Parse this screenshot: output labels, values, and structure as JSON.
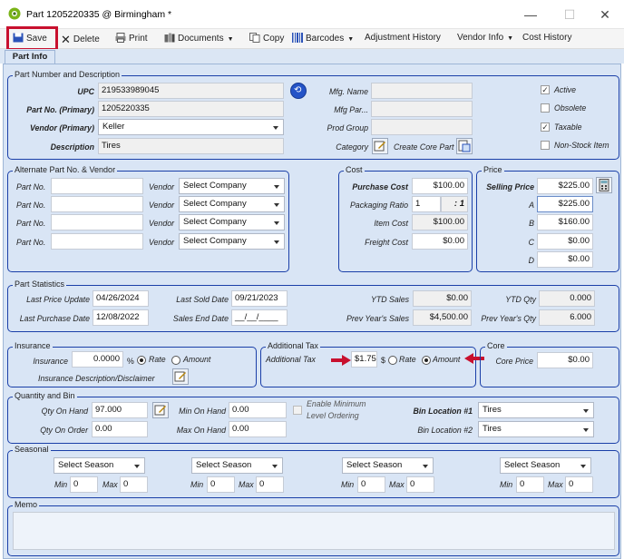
{
  "window": {
    "title": "Part 1205220335 @ Birmingham *",
    "minimize": "—",
    "maximize": "☐",
    "close": "✕"
  },
  "toolbar": {
    "save": "Save",
    "delete": "Delete",
    "print": "Print",
    "documents": "Documents",
    "copy": "Copy",
    "barcodes": "Barcodes",
    "adjustment_history": "Adjustment History",
    "vendor_info": "Vendor Info",
    "cost_history": "Cost History"
  },
  "tab": {
    "part_info": "Part Info"
  },
  "part_number": {
    "group": "Part Number and Description",
    "upc_label": "UPC",
    "upc": "219533989045",
    "partno_label": "Part No. (Primary)",
    "partno": "1205220335",
    "vendor_label": "Vendor (Primary)",
    "vendor": "Keller",
    "desc_label": "Description",
    "desc": "Tires",
    "mfg_name_label": "Mfg. Name",
    "mfg_part_label": "Mfg Par...",
    "prod_group_label": "Prod Group",
    "category_label": "Category",
    "create_core_label": "Create Core Part",
    "active_label": "Active",
    "active": "✓",
    "obsolete_label": "Obsolete",
    "taxable_label": "Taxable",
    "taxable": "✓",
    "nonstock_label": "Non-Stock Item"
  },
  "alternate": {
    "group": "Alternate Part No. & Vendor",
    "part_label": "Part No.",
    "vendor_label": "Vendor",
    "select": "Select Company"
  },
  "cost": {
    "group": "Cost",
    "purchase_label": "Purchase Cost",
    "purchase": "$100.00",
    "packaging_label": "Packaging Ratio",
    "packaging": "1",
    "ratio": ": 1",
    "item_label": "Item Cost",
    "item": "$100.00",
    "freight_label": "Freight Cost",
    "freight": "$0.00"
  },
  "price": {
    "group": "Price",
    "selling_label": "Selling Price",
    "selling": "$225.00",
    "a_label": "A",
    "a": "$225.00",
    "b_label": "B",
    "b": "$160.00",
    "c_label": "C",
    "c": "$0.00",
    "d_label": "D",
    "d": "$0.00"
  },
  "stats": {
    "group": "Part Statistics",
    "last_price_label": "Last Price Update",
    "last_price": "04/26/2024",
    "last_purchase_label": "Last Purchase Date",
    "last_purchase": "12/08/2022",
    "last_sold_label": "Last Sold Date",
    "last_sold": "09/21/2023",
    "sales_end_label": "Sales End Date",
    "sales_end": "__/__/____",
    "ytd_sales_label": "YTD Sales",
    "ytd_sales": "$0.00",
    "prev_sales_label": "Prev Year's Sales",
    "prev_sales": "$4,500.00",
    "ytd_qty_label": "YTD Qty",
    "ytd_qty": "0.000",
    "prev_qty_label": "Prev Year's Qty",
    "prev_qty": "6.000"
  },
  "insurance": {
    "group": "Insurance",
    "label": "Insurance",
    "value": "0.0000",
    "pct": "%",
    "rate": "Rate",
    "amount": "Amount",
    "desc_label": "Insurance Description/Disclaimer"
  },
  "additional_tax": {
    "group": "Additional Tax",
    "label": "Additional Tax",
    "value": "$1.75",
    "unit": "$",
    "rate": "Rate",
    "amount": "Amount"
  },
  "core": {
    "group": "Core",
    "label": "Core Price",
    "value": "$0.00"
  },
  "quantity": {
    "group": "Quantity and Bin",
    "qoh_label": "Qty On Hand",
    "qoh": "97.000",
    "qoo_label": "Qty On Order",
    "qoo": "0.00",
    "min_label": "Min On Hand",
    "min": "0.00",
    "max_label": "Max On Hand",
    "max": "0.00",
    "enable_min_label_1": "Enable Minimum",
    "enable_min_label_2": "Level Ordering",
    "bin1_label": "Bin Location #1",
    "bin1": "Tires",
    "bin2_label": "Bin Location #2",
    "bin2": "Tires"
  },
  "seasonal": {
    "group": "Seasonal",
    "select": "Select Season",
    "min_label": "Min",
    "max_label": "Max",
    "zero": "0"
  },
  "memo": {
    "group": "Memo"
  },
  "colors": {
    "highlight_box": "#c8102e",
    "group_border": "#1a3fa8",
    "panel_bg": "#d9e5f5"
  }
}
